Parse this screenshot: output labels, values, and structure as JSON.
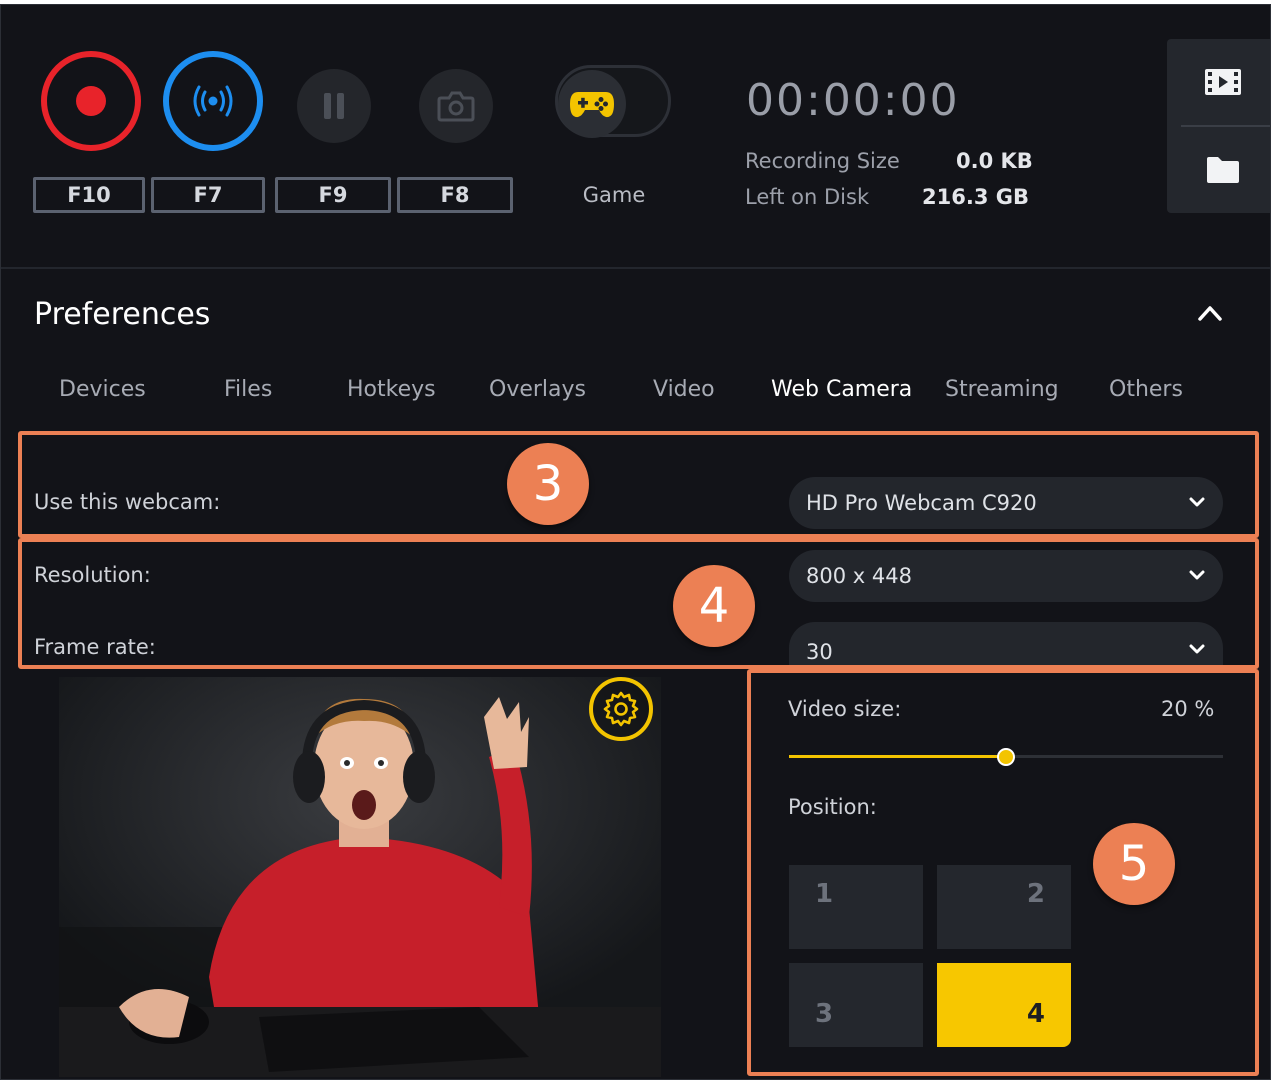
{
  "toolbar": {
    "hotkeys": [
      "F10",
      "F7",
      "F9",
      "F8"
    ],
    "game_label": "Game",
    "timer": "00:00:00",
    "recording_size_label": "Recording Size",
    "recording_size_value": "0.0 KB",
    "left_on_disk_label": "Left on Disk",
    "left_on_disk_value": "216.3 GB",
    "icons": [
      "record-icon",
      "stream-icon",
      "pause-icon",
      "camera-icon",
      "gamepad-icon",
      "film-icon",
      "folder-icon"
    ]
  },
  "preferences": {
    "title": "Preferences",
    "tabs": [
      "Devices",
      "Files",
      "Hotkeys",
      "Overlays",
      "Video",
      "Web Camera",
      "Streaming",
      "Others"
    ],
    "active_tab": "Web Camera"
  },
  "webcam": {
    "use_label": "Use this webcam:",
    "device": "HD Pro Webcam C920",
    "resolution_label": "Resolution:",
    "resolution": "800 x 448",
    "framerate_label": "Frame rate:",
    "framerate": "30"
  },
  "overlay": {
    "size_label": "Video size:",
    "size_value": "20 %",
    "size_fraction": 0.5,
    "position_label": "Position:",
    "positions": [
      "1",
      "2",
      "3",
      "4"
    ],
    "selected_position": "4"
  },
  "callouts": [
    "3",
    "4",
    "5"
  ],
  "colors": {
    "accent": "#f3c400",
    "record": "#e8232a",
    "stream": "#1d8ef0",
    "callout": "#ec8054",
    "background": "#121318"
  }
}
